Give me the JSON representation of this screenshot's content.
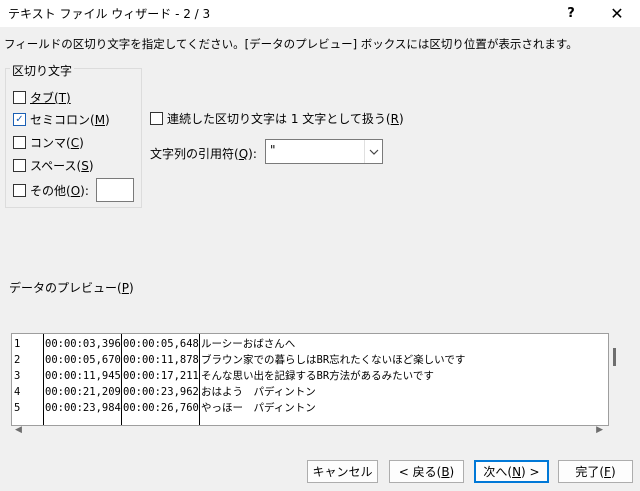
{
  "window": {
    "title": "テキスト ファイル ウィザード - 2 / 3",
    "help_label": "?",
    "close_label": "✕"
  },
  "instruction": "フィールドの区切り文字を指定してください。[データのプレビュー] ボックスには区切り位置が表示されます。",
  "delimiters": {
    "group_label": "区切り文字",
    "tab": {
      "text": "タブ(",
      "key": "T",
      "end": ")",
      "checked": false
    },
    "semicolon": {
      "text": "セミコロン(",
      "key": "M",
      "end": ")",
      "checked": true
    },
    "comma": {
      "text": "コンマ(",
      "key": "C",
      "end": ")",
      "checked": false
    },
    "space": {
      "text": "スペース(",
      "key": "S",
      "end": ")",
      "checked": false
    },
    "other": {
      "text": "その他(",
      "key": "O",
      "end": "):",
      "checked": false,
      "value": ""
    }
  },
  "consecutive": {
    "text": "連続した区切り文字は 1 文字として扱う(",
    "key": "R",
    "end": ")",
    "checked": false
  },
  "qualifier": {
    "text": "文字列の引用符(",
    "key": "Q",
    "end": "):",
    "value": "\""
  },
  "preview": {
    "label_text": "データのプレビュー(",
    "label_key": "P",
    "label_end": ")",
    "rows": [
      [
        "1",
        "00:00:03,396",
        "00:00:05,648",
        "ルーシーおばさんへ"
      ],
      [
        "2",
        "00:00:05,670",
        "00:00:11,878",
        "ブラウン家での暮らしはBR忘れたくないほど楽しいです"
      ],
      [
        "3",
        "00:00:11,945",
        "00:00:17,211",
        "そんな思い出を記録するBR方法があるみたいです"
      ],
      [
        "4",
        "00:00:21,209",
        "00:00:23,962",
        "おはよう　パディントン"
      ],
      [
        "5",
        "00:00:23,984",
        "00:00:26,760",
        "やっほー　パディントン"
      ]
    ]
  },
  "buttons": {
    "cancel": "キャンセル",
    "back": {
      "text": "< 戻る(",
      "key": "B",
      "end": ")"
    },
    "next": {
      "text": "次へ(",
      "key": "N",
      "end": ") >"
    },
    "finish": {
      "text": "完了(",
      "key": "F",
      "end": ")"
    }
  },
  "icons": {
    "checkbox_checked": "checkmark-icon",
    "dropdown": "chevron-down-icon",
    "scroll_left": "triangle-left-icon",
    "scroll_right": "triangle-right-icon",
    "help": "question-mark-icon",
    "close": "close-icon"
  },
  "colors": {
    "accent": "#0078d7",
    "checkbox_check": "#1a5fb4",
    "background": "#f0f0f0"
  }
}
